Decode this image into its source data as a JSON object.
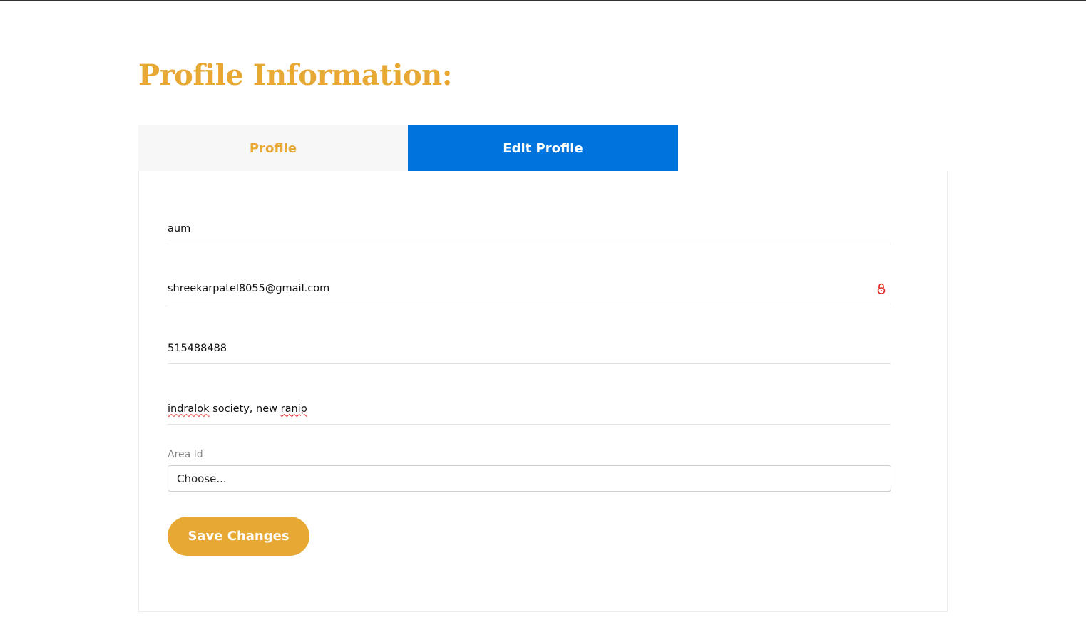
{
  "page": {
    "title": "Profile Information:"
  },
  "tabs": [
    {
      "label": "Profile",
      "active": false
    },
    {
      "label": "Edit Profile",
      "active": true
    }
  ],
  "form": {
    "name": {
      "value": "aum"
    },
    "email": {
      "value": "shreekarpatel8055@gmail.com",
      "icon": "lock-icon"
    },
    "phone": {
      "value": "515488488"
    },
    "address": {
      "value": "indralok society, new ranip",
      "part1": "indralok",
      "part2": " society, new ",
      "part3": "ranip"
    },
    "area": {
      "label": "Area Id",
      "selected": "Choose..."
    },
    "save_label": "Save Changes"
  },
  "colors": {
    "accent": "#e8a934",
    "active_tab": "#0074dc",
    "lock_icon": "#e02020"
  }
}
